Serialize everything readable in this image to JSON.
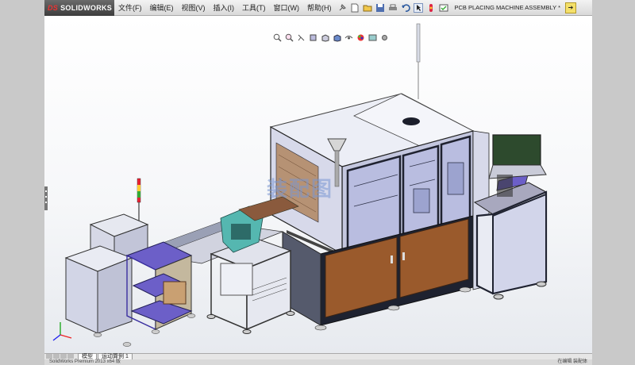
{
  "app": {
    "logo": "SOLIDWORKS",
    "logo_mark": "DS"
  },
  "menu": [
    "文件(F)",
    "编辑(E)",
    "视图(V)",
    "插入(I)",
    "工具(T)",
    "窗口(W)",
    "帮助(H)"
  ],
  "document": {
    "title": "PCB PLACING MACHINE ASSEMBLY *"
  },
  "toolbar_icons": [
    "pin-icon",
    "new-icon",
    "open-icon",
    "save-icon",
    "print-icon",
    "undo-icon",
    "select-icon",
    "rebuild-icon",
    "options-icon"
  ],
  "hud_icons": [
    "zoom-fit-icon",
    "zoom-area-icon",
    "previous-view-icon",
    "section-view-icon",
    "view-orientation-icon",
    "display-style-icon",
    "hide-show-icon",
    "edit-appearance-icon",
    "scene-icon",
    "view-settings-icon"
  ],
  "tabs": [
    "模型",
    "运动算例 1"
  ],
  "status": {
    "left": "SolidWorks Premium 2013 x64 版",
    "right": "在编辑 装配体"
  },
  "watermark": "装配图",
  "colors": {
    "cabinet": "#9a5a2c",
    "frame": "#1f2230",
    "panel": "#c8cbe6",
    "accent": "#6c5fc8",
    "monitor": "#2d4a2d",
    "teal": "#55b7b0"
  }
}
